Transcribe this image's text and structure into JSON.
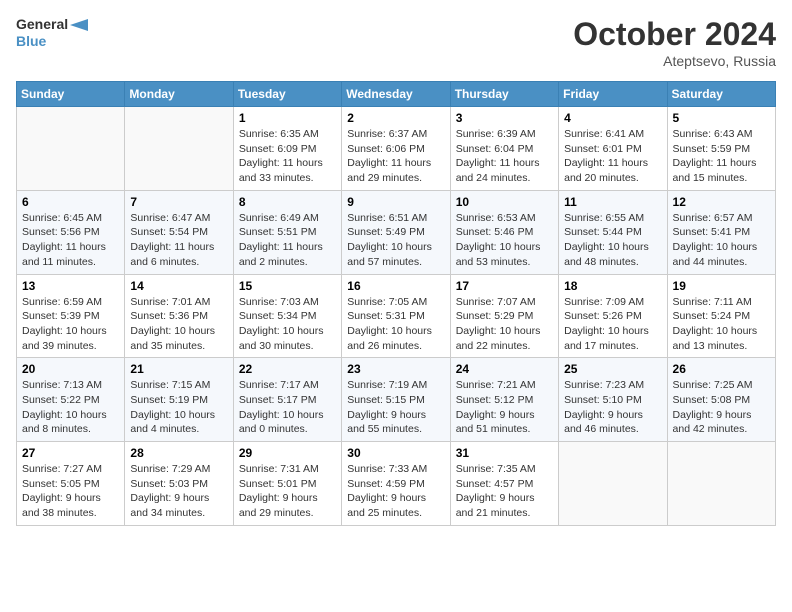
{
  "header": {
    "logo_line1": "General",
    "logo_line2": "Blue",
    "month_title": "October 2024",
    "location": "Ateptsevo, Russia"
  },
  "weekdays": [
    "Sunday",
    "Monday",
    "Tuesday",
    "Wednesday",
    "Thursday",
    "Friday",
    "Saturday"
  ],
  "weeks": [
    [
      {
        "day": "",
        "info": ""
      },
      {
        "day": "",
        "info": ""
      },
      {
        "day": "1",
        "info": "Sunrise: 6:35 AM\nSunset: 6:09 PM\nDaylight: 11 hours\nand 33 minutes."
      },
      {
        "day": "2",
        "info": "Sunrise: 6:37 AM\nSunset: 6:06 PM\nDaylight: 11 hours\nand 29 minutes."
      },
      {
        "day": "3",
        "info": "Sunrise: 6:39 AM\nSunset: 6:04 PM\nDaylight: 11 hours\nand 24 minutes."
      },
      {
        "day": "4",
        "info": "Sunrise: 6:41 AM\nSunset: 6:01 PM\nDaylight: 11 hours\nand 20 minutes."
      },
      {
        "day": "5",
        "info": "Sunrise: 6:43 AM\nSunset: 5:59 PM\nDaylight: 11 hours\nand 15 minutes."
      }
    ],
    [
      {
        "day": "6",
        "info": "Sunrise: 6:45 AM\nSunset: 5:56 PM\nDaylight: 11 hours\nand 11 minutes."
      },
      {
        "day": "7",
        "info": "Sunrise: 6:47 AM\nSunset: 5:54 PM\nDaylight: 11 hours\nand 6 minutes."
      },
      {
        "day": "8",
        "info": "Sunrise: 6:49 AM\nSunset: 5:51 PM\nDaylight: 11 hours\nand 2 minutes."
      },
      {
        "day": "9",
        "info": "Sunrise: 6:51 AM\nSunset: 5:49 PM\nDaylight: 10 hours\nand 57 minutes."
      },
      {
        "day": "10",
        "info": "Sunrise: 6:53 AM\nSunset: 5:46 PM\nDaylight: 10 hours\nand 53 minutes."
      },
      {
        "day": "11",
        "info": "Sunrise: 6:55 AM\nSunset: 5:44 PM\nDaylight: 10 hours\nand 48 minutes."
      },
      {
        "day": "12",
        "info": "Sunrise: 6:57 AM\nSunset: 5:41 PM\nDaylight: 10 hours\nand 44 minutes."
      }
    ],
    [
      {
        "day": "13",
        "info": "Sunrise: 6:59 AM\nSunset: 5:39 PM\nDaylight: 10 hours\nand 39 minutes."
      },
      {
        "day": "14",
        "info": "Sunrise: 7:01 AM\nSunset: 5:36 PM\nDaylight: 10 hours\nand 35 minutes."
      },
      {
        "day": "15",
        "info": "Sunrise: 7:03 AM\nSunset: 5:34 PM\nDaylight: 10 hours\nand 30 minutes."
      },
      {
        "day": "16",
        "info": "Sunrise: 7:05 AM\nSunset: 5:31 PM\nDaylight: 10 hours\nand 26 minutes."
      },
      {
        "day": "17",
        "info": "Sunrise: 7:07 AM\nSunset: 5:29 PM\nDaylight: 10 hours\nand 22 minutes."
      },
      {
        "day": "18",
        "info": "Sunrise: 7:09 AM\nSunset: 5:26 PM\nDaylight: 10 hours\nand 17 minutes."
      },
      {
        "day": "19",
        "info": "Sunrise: 7:11 AM\nSunset: 5:24 PM\nDaylight: 10 hours\nand 13 minutes."
      }
    ],
    [
      {
        "day": "20",
        "info": "Sunrise: 7:13 AM\nSunset: 5:22 PM\nDaylight: 10 hours\nand 8 minutes."
      },
      {
        "day": "21",
        "info": "Sunrise: 7:15 AM\nSunset: 5:19 PM\nDaylight: 10 hours\nand 4 minutes."
      },
      {
        "day": "22",
        "info": "Sunrise: 7:17 AM\nSunset: 5:17 PM\nDaylight: 10 hours\nand 0 minutes."
      },
      {
        "day": "23",
        "info": "Sunrise: 7:19 AM\nSunset: 5:15 PM\nDaylight: 9 hours\nand 55 minutes."
      },
      {
        "day": "24",
        "info": "Sunrise: 7:21 AM\nSunset: 5:12 PM\nDaylight: 9 hours\nand 51 minutes."
      },
      {
        "day": "25",
        "info": "Sunrise: 7:23 AM\nSunset: 5:10 PM\nDaylight: 9 hours\nand 46 minutes."
      },
      {
        "day": "26",
        "info": "Sunrise: 7:25 AM\nSunset: 5:08 PM\nDaylight: 9 hours\nand 42 minutes."
      }
    ],
    [
      {
        "day": "27",
        "info": "Sunrise: 7:27 AM\nSunset: 5:05 PM\nDaylight: 9 hours\nand 38 minutes."
      },
      {
        "day": "28",
        "info": "Sunrise: 7:29 AM\nSunset: 5:03 PM\nDaylight: 9 hours\nand 34 minutes."
      },
      {
        "day": "29",
        "info": "Sunrise: 7:31 AM\nSunset: 5:01 PM\nDaylight: 9 hours\nand 29 minutes."
      },
      {
        "day": "30",
        "info": "Sunrise: 7:33 AM\nSunset: 4:59 PM\nDaylight: 9 hours\nand 25 minutes."
      },
      {
        "day": "31",
        "info": "Sunrise: 7:35 AM\nSunset: 4:57 PM\nDaylight: 9 hours\nand 21 minutes."
      },
      {
        "day": "",
        "info": ""
      },
      {
        "day": "",
        "info": ""
      }
    ]
  ]
}
